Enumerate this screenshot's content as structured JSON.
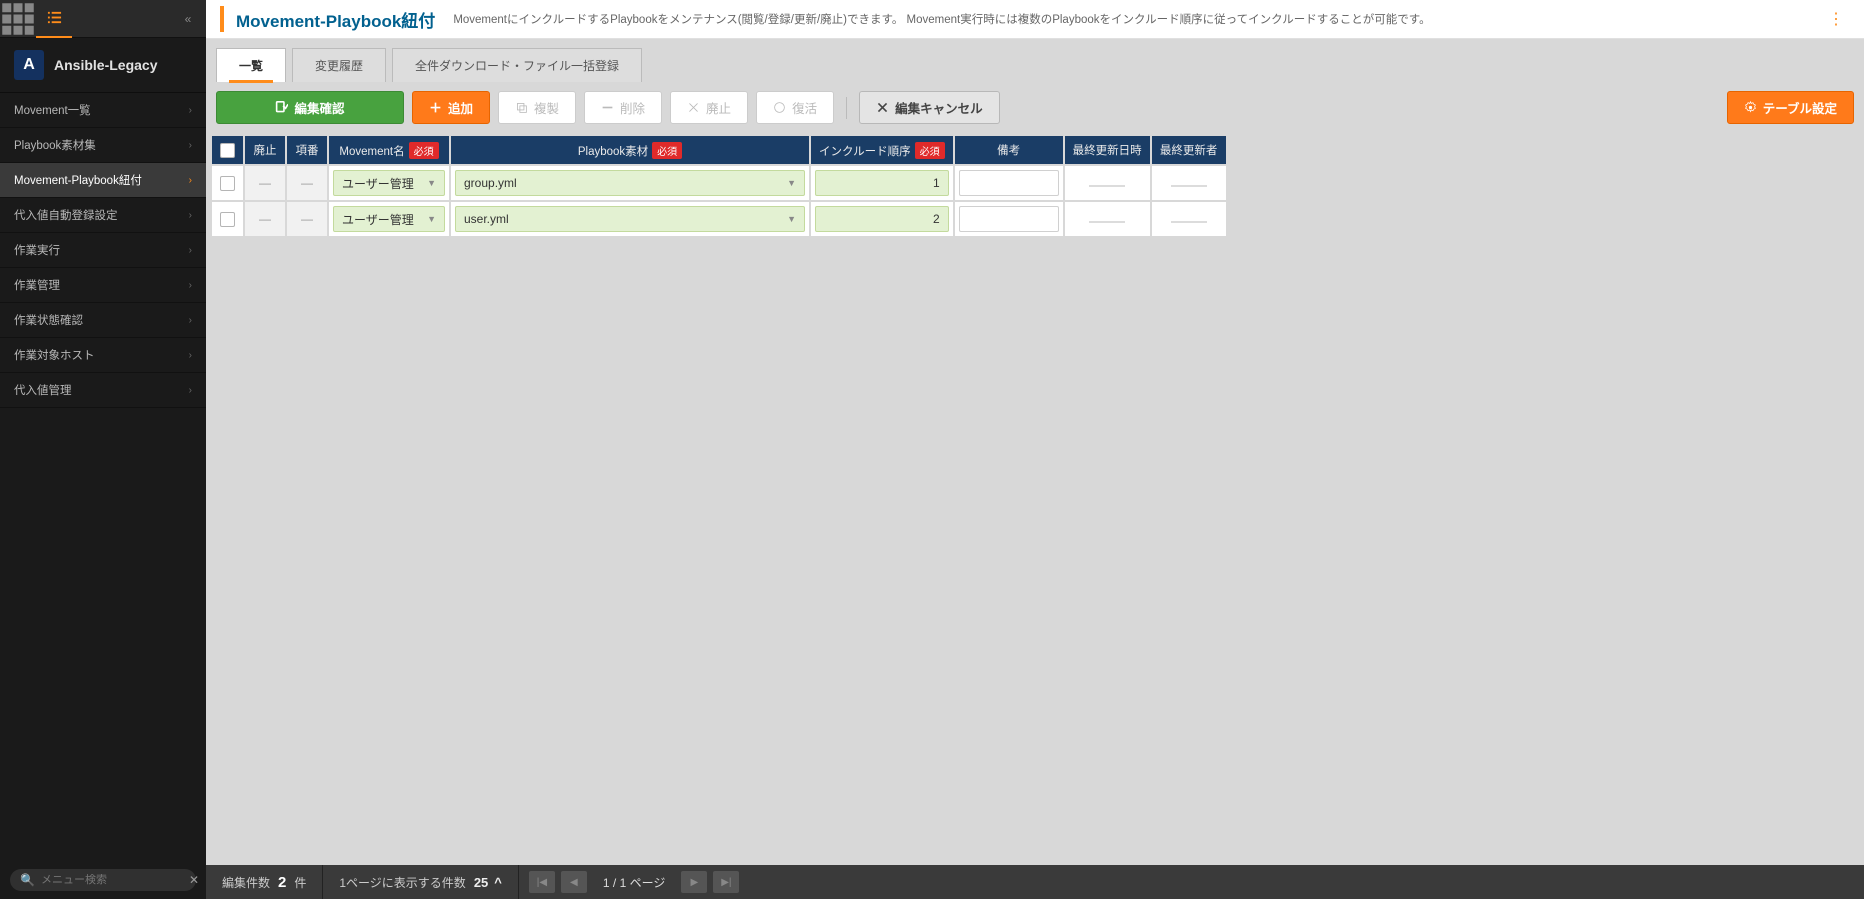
{
  "brand": "Ansible-Legacy",
  "sidebar": {
    "search_placeholder": "メニュー検索",
    "items": [
      {
        "label": "Movement一覧",
        "selected": false
      },
      {
        "label": "Playbook素材集",
        "selected": false
      },
      {
        "label": "Movement-Playbook紐付",
        "selected": true
      },
      {
        "label": "代入値自動登録設定",
        "selected": false
      },
      {
        "label": "作業実行",
        "selected": false
      },
      {
        "label": "作業管理",
        "selected": false
      },
      {
        "label": "作業状態確認",
        "selected": false
      },
      {
        "label": "作業対象ホスト",
        "selected": false
      },
      {
        "label": "代入値管理",
        "selected": false
      }
    ]
  },
  "header": {
    "title": "Movement-Playbook紐付",
    "desc": "MovementにインクルードするPlaybookをメンテナンス(閲覧/登録/更新/廃止)できます。 Movement実行時には複数のPlaybookをインクルード順序に従ってインクルードすることが可能です。"
  },
  "tabs": [
    {
      "label": "一覧",
      "active": true
    },
    {
      "label": "変更履歴",
      "active": false
    },
    {
      "label": "全件ダウンロード・ファイル一括登録",
      "active": false
    }
  ],
  "buttons": {
    "confirm": "編集確認",
    "add": "追加",
    "copy": "複製",
    "delete": "削除",
    "discard": "廃止",
    "revive": "復活",
    "cancel": "編集キャンセル",
    "tablecfg": "テーブル設定"
  },
  "columns": {
    "discard": "廃止",
    "num": "項番",
    "movement": "Movement名",
    "playbook": "Playbook素材",
    "order": "インクルード順序",
    "note": "備考",
    "updated": "最終更新日時",
    "updater": "最終更新者",
    "required": "必須"
  },
  "rows": [
    {
      "movement": "ユーザー管理",
      "playbook": "group.yml",
      "order": "1"
    },
    {
      "movement": "ユーザー管理",
      "playbook": "user.yml",
      "order": "2"
    }
  ],
  "footer": {
    "edit_label": "編集件数",
    "count": "2",
    "unit": "件",
    "per_label": "1ページに表示する件数",
    "per_value": "25",
    "page_cur": "1",
    "page_sep": "/",
    "page_total": "1 ページ"
  }
}
